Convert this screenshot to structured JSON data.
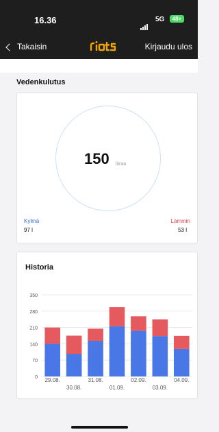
{
  "status_bar": {
    "time": "16.36",
    "network": "5G",
    "battery": "48+"
  },
  "nav": {
    "back_label": "Takaisin",
    "logo": "riots",
    "logout_label": "Kirjaudu ulos"
  },
  "usage": {
    "section_title": "Vedenkulutus",
    "total": "150",
    "unit": "litraa",
    "cold_label": "Kylmä",
    "cold_value": "97 l",
    "hot_label": "Lämmin",
    "hot_value": "53 l"
  },
  "history": {
    "title": "Historia"
  },
  "colors": {
    "cold": "#4a77e6",
    "hot": "#e55a5f",
    "logo": "#f0a500"
  },
  "chart_data": {
    "type": "bar",
    "stacked": true,
    "categories": [
      "29.08.",
      "30.08.",
      "31.08.",
      "01.09.",
      "02.09.",
      "03.09.",
      "04.09."
    ],
    "series": [
      {
        "values": [
          140,
          97,
          153,
          215,
          196,
          173,
          118
        ]
      },
      {
        "values": [
          70,
          78,
          52,
          82,
          62,
          72,
          56
        ]
      }
    ],
    "ylim": [
      0,
      350
    ],
    "yticks": [
      0,
      70,
      140,
      210,
      280,
      350
    ],
    "grid": true
  }
}
